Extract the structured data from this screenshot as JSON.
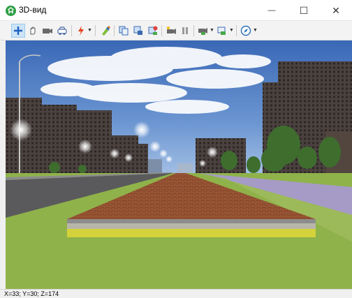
{
  "window": {
    "title": "3D-вид",
    "minimize_glyph": "—",
    "maximize_glyph": "☐",
    "close_glyph": "✕"
  },
  "toolbar": {
    "items": [
      {
        "name": "move-tool",
        "icon": "move-cross-icon",
        "active": true
      },
      {
        "name": "hand-tool",
        "icon": "hand-icon"
      },
      {
        "name": "camera-tool",
        "icon": "camera-icon"
      },
      {
        "name": "car-tool",
        "icon": "car-icon"
      },
      {
        "name": "light-tool",
        "icon": "lightning-icon",
        "dropdown": true
      },
      {
        "name": "paint-tool",
        "icon": "paint-icon"
      },
      {
        "name": "copy-view",
        "icon": "copy-view-icon"
      },
      {
        "name": "save-view",
        "icon": "save-view-icon"
      },
      {
        "name": "export-view",
        "icon": "export-view-icon"
      },
      {
        "name": "record-camera",
        "icon": "record-camera-icon"
      },
      {
        "name": "pause",
        "icon": "pause-icon"
      },
      {
        "name": "camera-settings",
        "icon": "camera-settings-icon",
        "dropdown": true
      },
      {
        "name": "display-settings",
        "icon": "display-settings-icon",
        "dropdown": true
      },
      {
        "name": "navigation",
        "icon": "compass-icon",
        "dropdown": true
      }
    ]
  },
  "status": {
    "coordinates": "X=33; Y=30; Z=174"
  },
  "colors": {
    "accent": "#0078d7",
    "sky_top": "#3f6fb8",
    "grass": "#8fb24a",
    "road": "#5a5a5c",
    "brick": "#8a4a2c",
    "curb_yellow": "#d4d23a",
    "sidewalk": "#a59bc6"
  }
}
